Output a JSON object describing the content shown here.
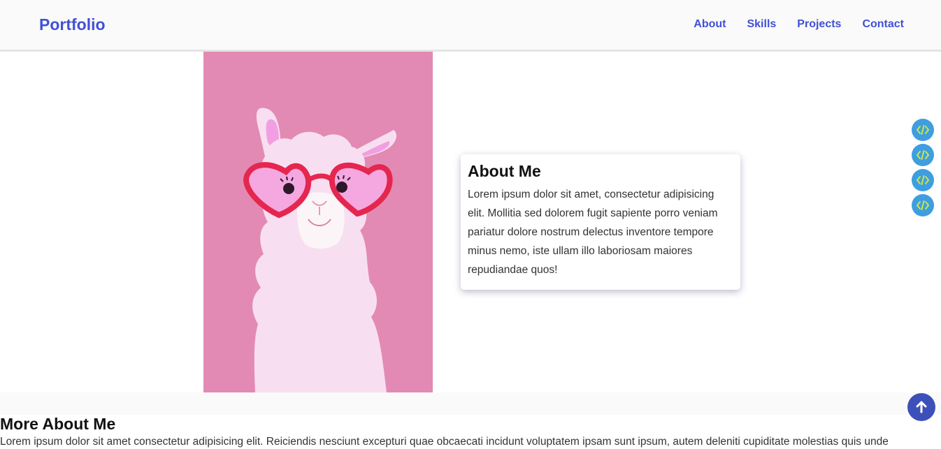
{
  "header": {
    "brand": "Portfolio",
    "nav": [
      "About",
      "Skills",
      "Projects",
      "Contact"
    ]
  },
  "hero": {
    "image_icon": "llama-with-heart-glasses-illustration"
  },
  "about_card": {
    "title": "About Me",
    "text": "Lorem ipsum dolor sit amet, consectetur adipisicing elit. Mollitia sed dolorem fugit sapiente porro veniam pariatur dolore nostrum delectus inventore tempore minus nemo, iste ullam illo laboriosam maiores repudiandae quos!"
  },
  "side_icons": [
    "code-icon",
    "code-icon",
    "code-icon",
    "code-icon"
  ],
  "scroll_top_icon": "arrow-up-icon",
  "more_about": {
    "title": "More About Me",
    "text": "Lorem ipsum dolor sit amet consectetur adipisicing elit. Reiciendis nesciunt excepturi quae obcaecati incidunt voluptatem ipsam sunt ipsum, autem deleniti cupiditate molestias quis unde"
  },
  "colors": {
    "accent": "#4150d6",
    "hero_bg": "#e28ab3",
    "icon_bg": "#3f9ee0",
    "icon_fg": "#c8e64a",
    "scroll_top_bg": "#3d4fb8"
  }
}
